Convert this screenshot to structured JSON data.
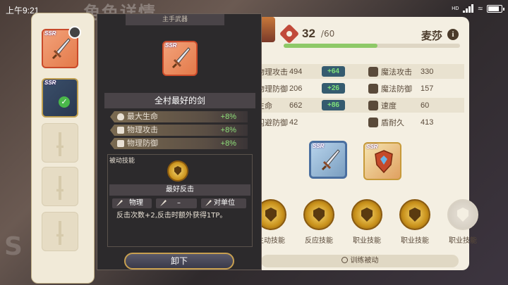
{
  "status_bar": {
    "time": "上午9:21",
    "signal_label": "HD"
  },
  "background": {
    "title": "角色详情",
    "side_letter": "S"
  },
  "character": {
    "name": "麦莎",
    "level": "32",
    "level_max": "/60",
    "level_fraction": 0.53
  },
  "stats": [
    {
      "label": "物理攻击",
      "value": "494",
      "delta": "+64",
      "label2": "魔法攻击",
      "value2": "330"
    },
    {
      "label": "物理防御",
      "value": "206",
      "delta": "+26",
      "label2": "魔法防御",
      "value2": "157"
    },
    {
      "label": "生命",
      "value": "662",
      "delta": "+86",
      "label2": "速度",
      "value2": "60"
    },
    {
      "label": "闪避防御",
      "value": "42",
      "delta": "",
      "label2": "盾耐久",
      "value2": "413"
    }
  ],
  "equipment": {
    "rarity_label": "SSR"
  },
  "skills": [
    {
      "label": "主动技能",
      "locked": false
    },
    {
      "label": "反应技能",
      "locked": false
    },
    {
      "label": "职业技能",
      "locked": false
    },
    {
      "label": "职业技能",
      "locked": false
    },
    {
      "label": "职业技能",
      "locked": true
    }
  ],
  "train_passive": "训练被动",
  "popup": {
    "header": "主手武器",
    "item_name": "全村最好的剑",
    "attributes": [
      {
        "label": "最大生命",
        "value": "+8%",
        "icon": "heart-icon"
      },
      {
        "label": "物理攻击",
        "value": "+8%",
        "icon": "sword-icon"
      },
      {
        "label": "物理防御",
        "value": "+8%",
        "icon": "shield-icon"
      }
    ],
    "passive_tag": "被动技能",
    "passive_name": "最好反击",
    "passive_type": "物理",
    "passive_cost": "–",
    "passive_target": "对单位",
    "passive_desc": "反击次数+2,反击时额外获得1TP。",
    "unequip_label": "卸下"
  }
}
